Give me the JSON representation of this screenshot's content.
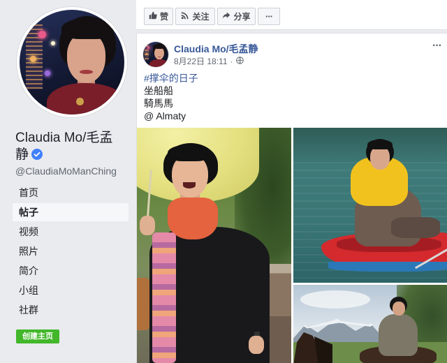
{
  "page": {
    "name": "Claudia Mo/毛孟静",
    "verified_icon": "verified-badge-icon",
    "username": "@ClaudiaMoManChing"
  },
  "sidebar": {
    "items": [
      {
        "label": "首页",
        "selected": false
      },
      {
        "label": "帖子",
        "selected": true
      },
      {
        "label": "视频",
        "selected": false
      },
      {
        "label": "照片",
        "selected": false
      },
      {
        "label": "简介",
        "selected": false
      },
      {
        "label": "小组",
        "selected": false
      },
      {
        "label": "社群",
        "selected": false
      }
    ],
    "create_page_label": "创建主页"
  },
  "actions": {
    "like_label": "赞",
    "like_icon": "thumbs-up-icon",
    "follow_label": "关注",
    "follow_icon": "rss-icon",
    "share_label": "分享",
    "share_icon": "share-arrow-icon",
    "more_label": "···"
  },
  "post": {
    "author": "Claudia Mo/毛孟静",
    "timestamp": "8月22日 18:11",
    "separator": "·",
    "audience_icon": "globe-icon",
    "more_label": "···",
    "hashtag": "#撑伞的日子",
    "lines": [
      "坐船船",
      "騎馬馬",
      "@ Almaty"
    ]
  },
  "colors": {
    "sidebar_bg": "#e9ebee",
    "link": "#385898",
    "verified_badge": "#4080ff",
    "create_button": "#42b72a",
    "button_border": "#ccd0d5"
  }
}
